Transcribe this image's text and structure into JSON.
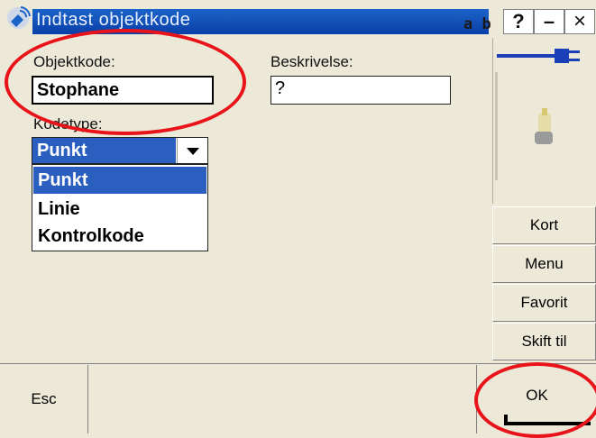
{
  "titlebar": {
    "title": "Indtast objektkode",
    "input_mode": "a b",
    "help": "?",
    "minimize": "–",
    "close": "×"
  },
  "form": {
    "objektkode_label": "Objektkode:",
    "objektkode_value": "Stophane",
    "beskrivelse_label": "Beskrivelse:",
    "beskrivelse_value": "?",
    "kodetype_label": "Kodetype:",
    "kodetype_value": "Punkt",
    "kodetype_options": [
      "Punkt",
      "Linie",
      "Kontrolkode"
    ],
    "kodetype_selected_index": 0
  },
  "side_buttons": {
    "kort": "Kort",
    "menu": "Menu",
    "favorit": "Favorit",
    "skift": "Skift til"
  },
  "bottom": {
    "esc": "Esc",
    "ok": "OK"
  },
  "icons": {
    "app": "satellite-icon",
    "power": "power-plug-icon",
    "device": "instrument-icon"
  },
  "colors": {
    "title_bar": "#0a3fa8",
    "selection": "#2a5fc0",
    "annotation": "#e8141a",
    "background": "#ece9d8"
  }
}
